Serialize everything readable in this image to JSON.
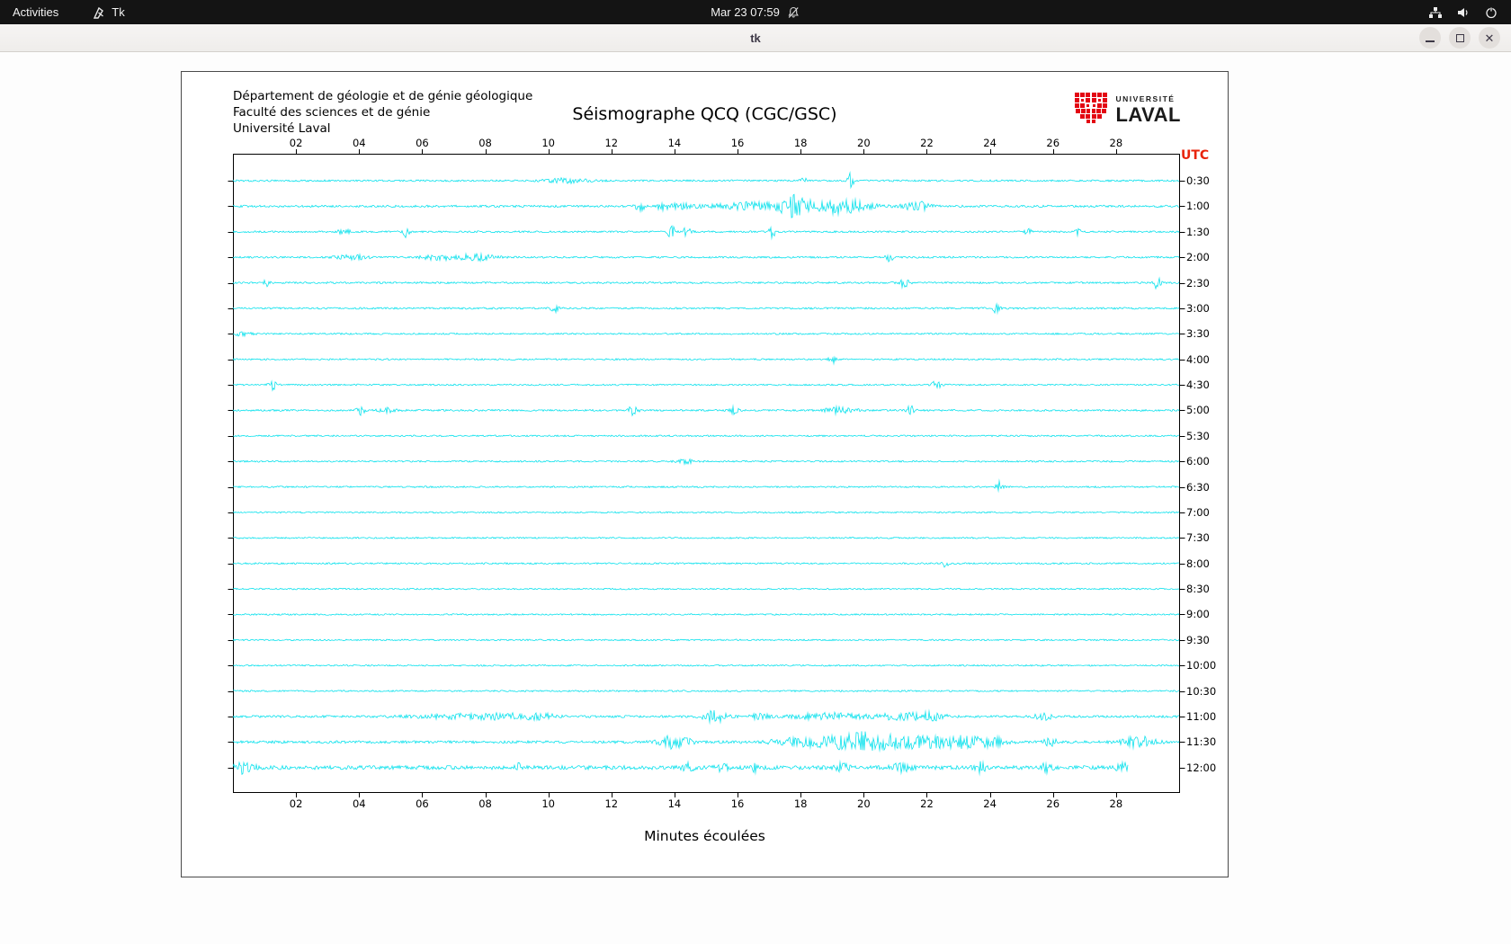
{
  "topbar": {
    "activities_label": "Activities",
    "app_indicator_label": "Tk",
    "clock": "Mar 23 07:59"
  },
  "window": {
    "title": "tk",
    "close_glyph": "✕"
  },
  "app": {
    "institution_lines": [
      "Département de géologie et de génie géologique",
      "Faculté des sciences et de génie",
      "Université Laval"
    ],
    "title": "Séismographe QCQ (CGC/GSC)",
    "utc_label": "UTC",
    "x_axis_title": "Minutes écoulées",
    "logo": {
      "word_small": "UNIVERSITÉ",
      "word_large": "LAVAL",
      "shield_color": "#e30613"
    }
  },
  "icons": {
    "app_indicator": "tk-feather-icon",
    "notifications": "bell-slash-icon",
    "status": [
      "network-nodes-icon",
      "volume-icon",
      "power-icon"
    ]
  },
  "chart_data": {
    "type": "line",
    "title": "Séismographe QCQ (CGC/GSC)",
    "xlabel": "Minutes écoulées",
    "ylabel": "UTC",
    "x_range_minutes": [
      0,
      30
    ],
    "x_tick_minutes": [
      2,
      4,
      6,
      8,
      10,
      12,
      14,
      16,
      18,
      20,
      22,
      24,
      26,
      28
    ],
    "x_tick_labels": [
      "02",
      "04",
      "06",
      "08",
      "10",
      "12",
      "14",
      "16",
      "18",
      "20",
      "22",
      "24",
      "26",
      "28"
    ],
    "grid": false,
    "legend": "none",
    "trace_color": "#00E0EC",
    "row_duration_minutes": 30,
    "rows": [
      {
        "label": "0:30",
        "base": 1.0,
        "events": [
          [
            10.6,
            2.5,
            0.7
          ],
          [
            18.1,
            3.5,
            0.1
          ],
          [
            19.6,
            9,
            0.1
          ]
        ]
      },
      {
        "label": "1:00",
        "base": 1.2,
        "events": [
          [
            12.9,
            5,
            0.15
          ],
          [
            13.6,
            4,
            0.2
          ],
          [
            14.2,
            3.5,
            0.3
          ],
          [
            17.7,
            6,
            2.2
          ],
          [
            17.8,
            9,
            0.3
          ],
          [
            19.4,
            5,
            0.6
          ],
          [
            21.7,
            5,
            0.4
          ]
        ]
      },
      {
        "label": "1:30",
        "base": 1.0,
        "events": [
          [
            3.5,
            3,
            0.2
          ],
          [
            5.5,
            6,
            0.1
          ],
          [
            13.9,
            7,
            0.12
          ],
          [
            14.4,
            6,
            0.12
          ],
          [
            17.1,
            7,
            0.1
          ],
          [
            25.2,
            3.5,
            0.12
          ],
          [
            26.8,
            5,
            0.1
          ]
        ]
      },
      {
        "label": "2:00",
        "base": 1.0,
        "events": [
          [
            3.8,
            2.5,
            0.5
          ],
          [
            6.5,
            3,
            0.5
          ],
          [
            7.7,
            3.5,
            0.6
          ],
          [
            20.8,
            5,
            0.12
          ]
        ]
      },
      {
        "label": "2:30",
        "base": 1.0,
        "events": [
          [
            1.1,
            8,
            0.1
          ],
          [
            21.3,
            6,
            0.15
          ],
          [
            29.3,
            8,
            0.1
          ]
        ]
      },
      {
        "label": "3:00",
        "base": 1.0,
        "events": [
          [
            10.2,
            7,
            0.1
          ],
          [
            24.2,
            5,
            0.12
          ]
        ]
      },
      {
        "label": "3:30",
        "base": 0.9,
        "events": [
          [
            0.3,
            2,
            0.3
          ]
        ]
      },
      {
        "label": "4:00",
        "base": 0.9,
        "events": [
          [
            19.0,
            5.5,
            0.1
          ]
        ]
      },
      {
        "label": "4:30",
        "base": 0.9,
        "events": [
          [
            1.25,
            6,
            0.12
          ],
          [
            22.3,
            4.5,
            0.15
          ]
        ]
      },
      {
        "label": "5:00",
        "base": 1.0,
        "events": [
          [
            4.05,
            6,
            0.12
          ],
          [
            4.9,
            2.5,
            0.3
          ],
          [
            12.7,
            6,
            0.15
          ],
          [
            15.9,
            4.5,
            0.12
          ],
          [
            19.3,
            4,
            0.5
          ],
          [
            21.5,
            6,
            0.12
          ]
        ]
      },
      {
        "label": "5:30",
        "base": 0.9,
        "events": []
      },
      {
        "label": "6:00",
        "base": 0.9,
        "events": [
          [
            14.4,
            2.5,
            0.3
          ]
        ]
      },
      {
        "label": "6:30",
        "base": 0.9,
        "events": [
          [
            24.3,
            6,
            0.12
          ]
        ]
      },
      {
        "label": "7:00",
        "base": 0.85,
        "events": []
      },
      {
        "label": "7:30",
        "base": 0.85,
        "events": []
      },
      {
        "label": "8:00",
        "base": 0.9,
        "events": [
          [
            22.6,
            7,
            0.1
          ]
        ]
      },
      {
        "label": "8:30",
        "base": 0.85,
        "events": []
      },
      {
        "label": "9:00",
        "base": 0.85,
        "events": []
      },
      {
        "label": "9:30",
        "base": 0.85,
        "events": []
      },
      {
        "label": "10:00",
        "base": 0.85,
        "events": []
      },
      {
        "label": "10:30",
        "base": 0.9,
        "events": []
      },
      {
        "label": "11:00",
        "base": 1.3,
        "events": [
          [
            6.9,
            2.5,
            1.2
          ],
          [
            8.6,
            3,
            0.8
          ],
          [
            9.75,
            3,
            0.5
          ],
          [
            15.3,
            7,
            0.35
          ],
          [
            16.7,
            3,
            0.3
          ],
          [
            18.9,
            4,
            1.0
          ],
          [
            21.2,
            4,
            0.8
          ],
          [
            22.2,
            4,
            0.4
          ],
          [
            25.7,
            3.5,
            0.3
          ]
        ]
      },
      {
        "label": "11:30",
        "base": 1.5,
        "events": [
          [
            14.0,
            7,
            0.5
          ],
          [
            18.3,
            5,
            1.2
          ],
          [
            19.9,
            9,
            0.8
          ],
          [
            21.4,
            7,
            1.0
          ],
          [
            23.0,
            6,
            0.8
          ],
          [
            24.0,
            5,
            0.5
          ],
          [
            25.9,
            4,
            0.25
          ],
          [
            28.7,
            6,
            0.5
          ]
        ]
      },
      {
        "label": "12:00",
        "base": 2.2,
        "end": 28.4,
        "events": [
          [
            0.35,
            6,
            0.3
          ],
          [
            9.0,
            4,
            0.15
          ],
          [
            14.4,
            5,
            0.2
          ],
          [
            15.5,
            4,
            0.2
          ],
          [
            16.6,
            6,
            0.12
          ],
          [
            19.3,
            5,
            0.2
          ],
          [
            21.2,
            4,
            0.3
          ],
          [
            23.7,
            5,
            0.15
          ],
          [
            25.8,
            5,
            0.15
          ],
          [
            28.2,
            4,
            0.2
          ]
        ]
      }
    ]
  }
}
